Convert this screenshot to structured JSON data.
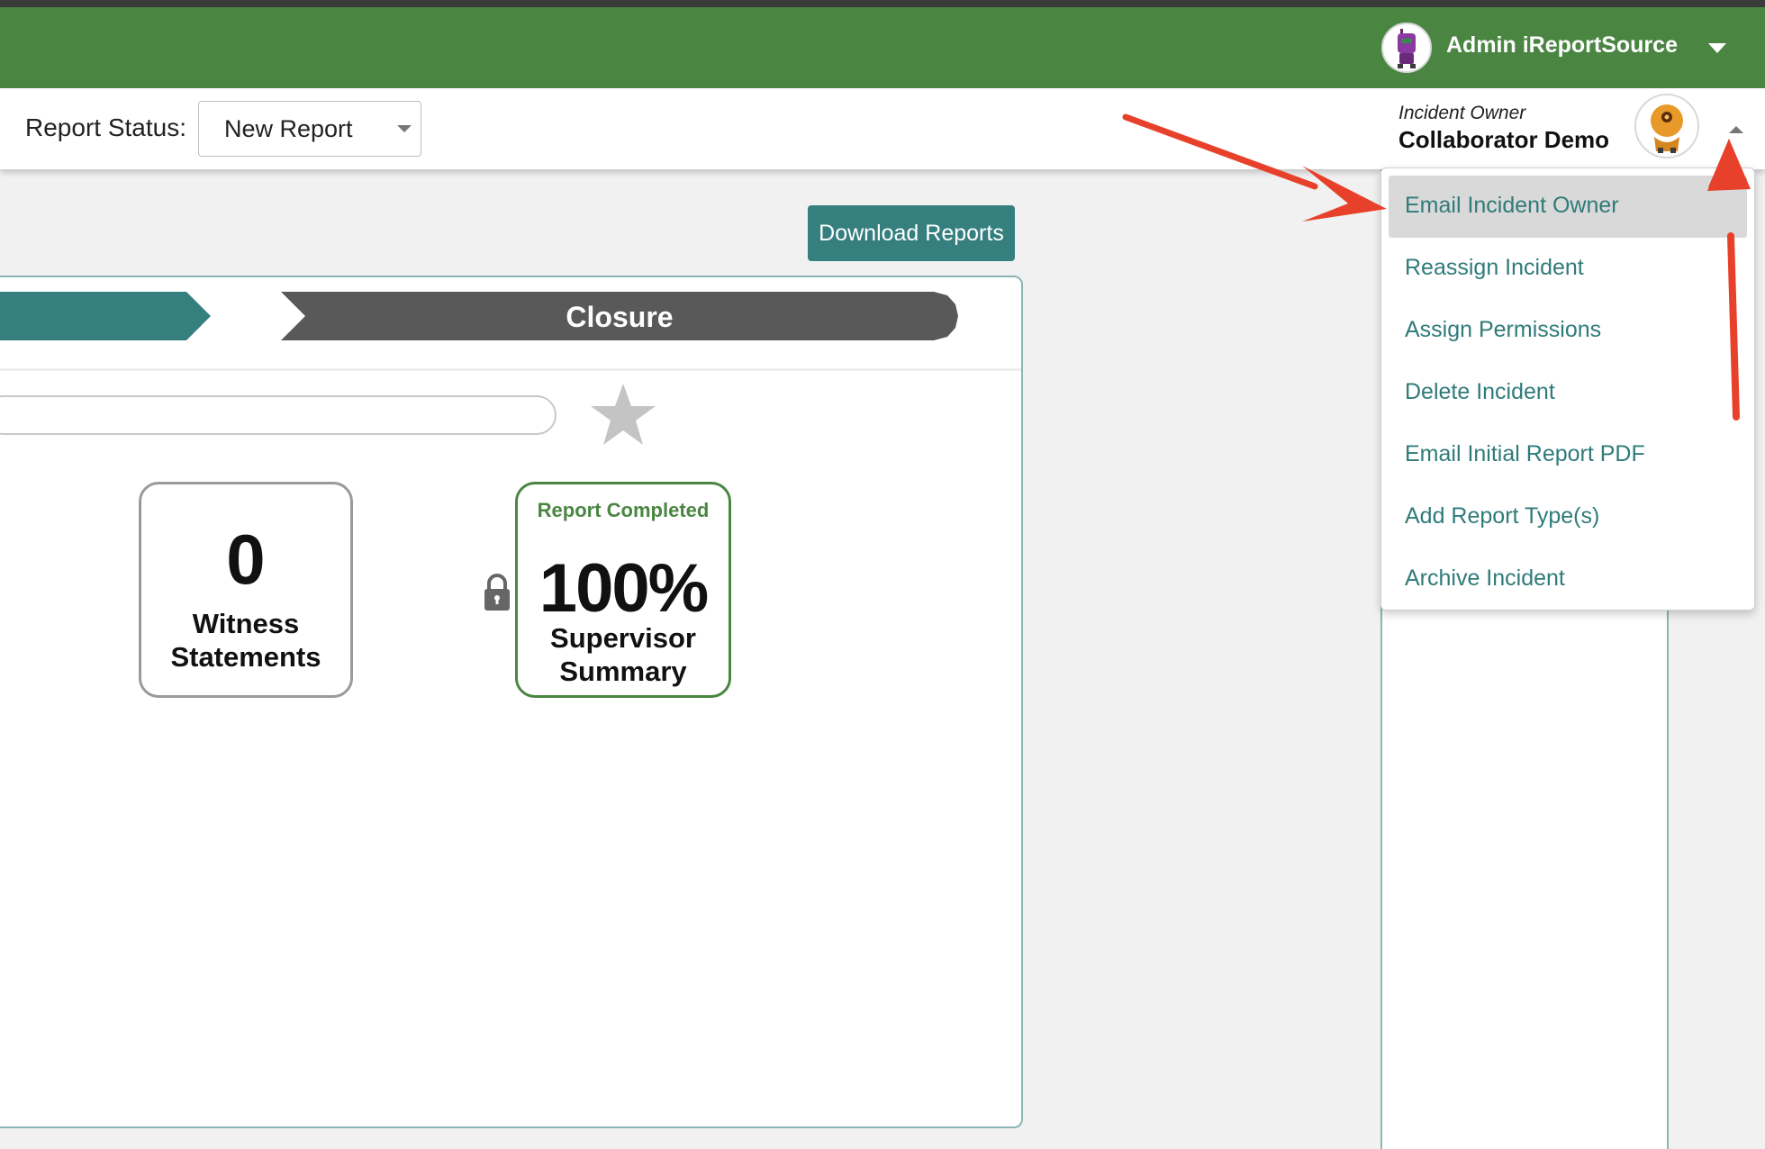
{
  "header": {
    "user_name": "Admin iReportSource",
    "avatar_icon": "robot-avatar-icon",
    "caret_icon": "caret-down-icon"
  },
  "toolbar": {
    "status_label": "Report Status:",
    "status_value": "New Report",
    "owner_role": "Incident Owner",
    "owner_name": "Collaborator Demo",
    "owner_avatar_icon": "robot-avatar-icon",
    "owner_caret_icon": "caret-up-icon"
  },
  "actions": {
    "download_label": "Download Reports"
  },
  "steps": {
    "closure_label": "Closure"
  },
  "cards": {
    "witness": {
      "count": "0",
      "label_line1": "Witness",
      "label_line2": "Statements"
    },
    "summary": {
      "status": "Report Completed",
      "percent": "100%",
      "label_line1": "Supervisor",
      "label_line2": "Summary"
    }
  },
  "menu": {
    "items": [
      "Email Incident Owner",
      "Reassign Incident",
      "Assign Permissions",
      "Delete Incident",
      "Email Initial Report PDF",
      "Add Report Type(s)",
      "Archive Incident"
    ],
    "highlighted_index": 0
  },
  "colors": {
    "header_green": "#4a8642",
    "teal": "#357f7e",
    "step_gray": "#595959",
    "annotation_red": "#e8412b"
  }
}
